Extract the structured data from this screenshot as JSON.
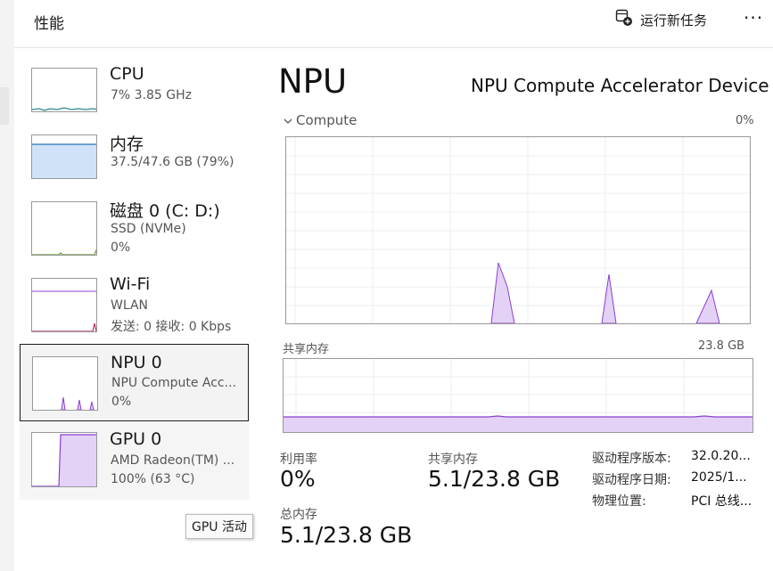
{
  "header": {
    "title": "性能",
    "run_task_label": "运行新任务",
    "more_label": "···"
  },
  "sidebar": {
    "items": [
      {
        "name": "CPU",
        "line1": "7% 3.85 GHz",
        "line2": ""
      },
      {
        "name": "内存",
        "line1": "37.5/47.6 GB (79%)",
        "line2": ""
      },
      {
        "name": "磁盘 0 (C: D:)",
        "line1": "SSD (NVMe)",
        "line2": "0%"
      },
      {
        "name": "Wi-Fi",
        "line1": "WLAN",
        "line2": "发送: 0 接收: 0 Kbps"
      },
      {
        "name": "NPU 0",
        "line1": "NPU Compute Acc...",
        "line2": "0%"
      },
      {
        "name": "GPU 0",
        "line1": "AMD Radeon(TM) ...",
        "line2": "100% (63 °C)"
      }
    ]
  },
  "main": {
    "title": "NPU",
    "device_name": "NPU Compute Accelerator Device",
    "compute_label": "Compute",
    "compute_value": "0%",
    "shared_mem_label": "共享内存",
    "shared_mem_max": "23.8 GB",
    "stats": {
      "utilization_label": "利用率",
      "utilization_value": "0%",
      "shared_label": "共享内存",
      "shared_value": "5.1/23.8 GB",
      "total_label": "总内存",
      "total_value": "5.1/23.8 GB"
    },
    "details": [
      {
        "key": "驱动程序版本:",
        "value": "32.0.20..."
      },
      {
        "key": "驱动程序日期:",
        "value": "2025/1..."
      },
      {
        "key": "物理位置:",
        "value": "PCI 总线..."
      }
    ]
  },
  "tooltip": "GPU 活动",
  "colors": {
    "accent_purple": "#8b3fd1",
    "fill_purple": "#e3d2f5",
    "memory_blue": "#cfe2f8",
    "cpu_teal": "#2a8a8a"
  }
}
